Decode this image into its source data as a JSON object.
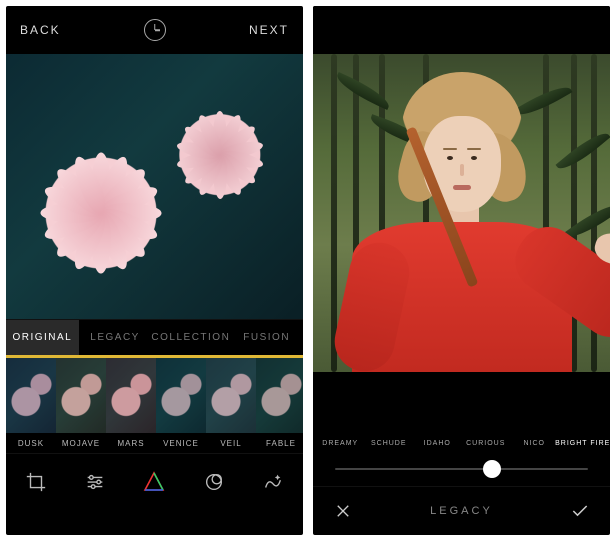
{
  "left": {
    "nav": {
      "back": "BACK",
      "next": "NEXT"
    },
    "tabs": [
      {
        "label": "ORIGINAL",
        "active": true
      },
      {
        "label": "LEGACY"
      },
      {
        "label": "COLLECTION"
      },
      {
        "label": "FUSION"
      }
    ],
    "filters": [
      {
        "label": "DUSK",
        "bar": "#e0b836",
        "tint": "rgba(40,50,80,0.35)"
      },
      {
        "label": "MOJAVE",
        "bar": "#e0b836",
        "tint": "rgba(90,70,40,0.30)"
      },
      {
        "label": "MARS",
        "bar": "#e0b836",
        "tint": "rgba(120,50,50,0.30)"
      },
      {
        "label": "VENICE",
        "bar": "#e0b836",
        "tint": "rgba(20,60,70,0.35)"
      },
      {
        "label": "VEIL",
        "bar": "#e0b836",
        "tint": "rgba(60,80,90,0.35)"
      },
      {
        "label": "FABLE",
        "bar": "#e0b836",
        "tint": "rgba(30,60,50,0.35)"
      }
    ],
    "tools": [
      "crop-icon",
      "adjust-icon",
      "prism-icon",
      "vignette-icon",
      "effects-icon"
    ]
  },
  "right": {
    "filters": [
      {
        "label": "DREAMY",
        "tint": "rgba(255,230,200,0.25)"
      },
      {
        "label": "SCHUDE",
        "tint": "rgba(120,40,80,0.35)"
      },
      {
        "label": "IDAHO",
        "tint": "rgba(180,60,60,0.30)"
      },
      {
        "label": "CURIOUS",
        "tint": "rgba(200,150,100,0.25)"
      },
      {
        "label": "NICO",
        "tint": "rgba(80,90,70,0.35)"
      },
      {
        "label": "BRIGHT FIRE",
        "tint": "rgba(255,200,120,0.25)",
        "active": true
      }
    ],
    "slider": {
      "value": 0.62
    },
    "bottom": {
      "label": "LEGACY"
    }
  }
}
